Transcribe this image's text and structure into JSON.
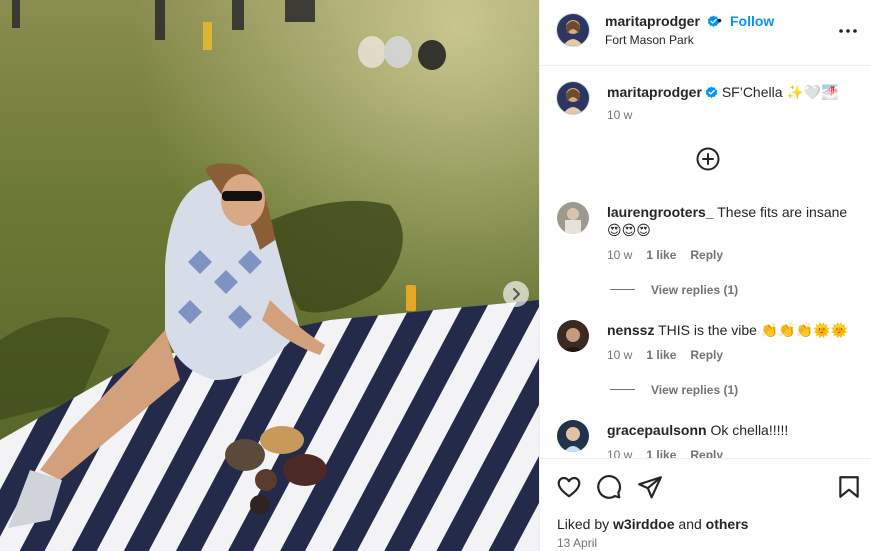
{
  "post": {
    "username": "maritaprodger",
    "follow_label": "Follow",
    "separator": "•",
    "location": "Fort Mason Park",
    "caption_text": "SF’Chella ✨🤍🌁",
    "caption_time": "10 w"
  },
  "comments": [
    {
      "username": "laurengrooters_",
      "text": "These fits are insane 😍😍😍",
      "time": "10 w",
      "likes": "1 like",
      "reply_label": "Reply",
      "view_replies": "View replies (1)"
    },
    {
      "username": "nenssz",
      "text": "THIS is the vibe 👏👏👏🌞🌞",
      "time": "10 w",
      "likes": "1 like",
      "reply_label": "Reply",
      "view_replies": "View replies (1)"
    },
    {
      "username": "gracepaulsonn",
      "text": "Ok chella!!!!!",
      "time": "10 w",
      "likes": "1 like",
      "reply_label": "Reply"
    }
  ],
  "footer": {
    "liked_prefix": "Liked by ",
    "liked_user": "w3irddoe",
    "liked_and": " and ",
    "liked_others": "others",
    "date": "13 April"
  },
  "icons": {
    "verified": "verified-badge-icon",
    "more": "more-options-icon",
    "add_comment": "add-circle-icon",
    "like": "heart-icon",
    "comment": "comment-bubble-icon",
    "share": "paper-plane-icon",
    "save": "bookmark-icon",
    "next": "chevron-right-icon"
  },
  "colors": {
    "accent": "#0095f6",
    "verified": "#0095f6",
    "text": "#262626",
    "secondary": "#737373"
  }
}
